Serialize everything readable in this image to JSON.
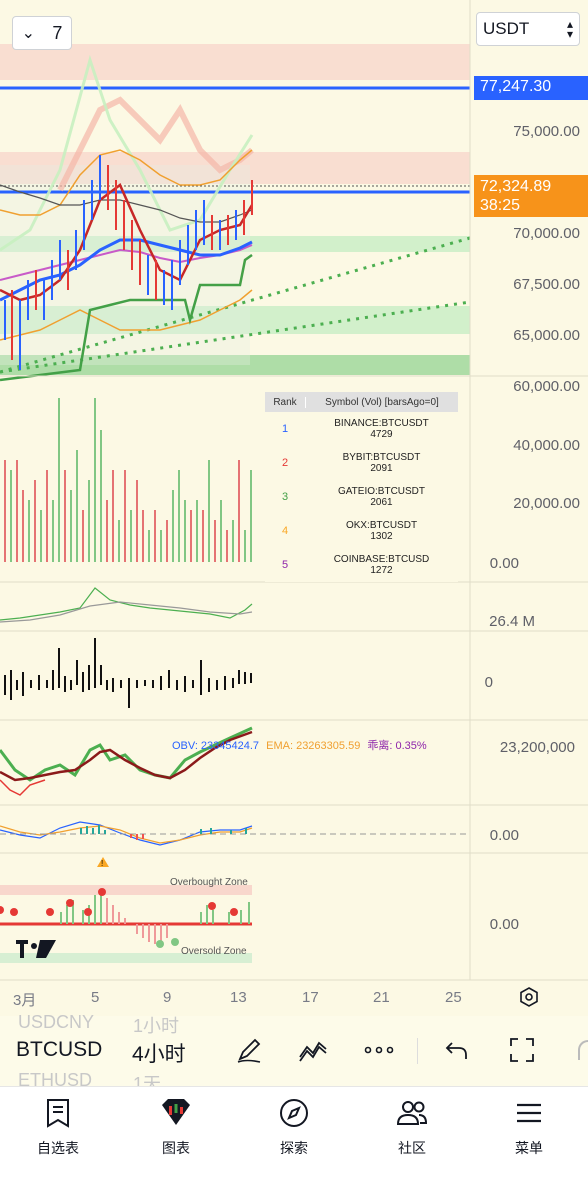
{
  "toolbar_top": {
    "interval_button": {
      "chevron": "chevron-down-icon",
      "value": "7"
    },
    "currency_button": {
      "label": "USDT",
      "icon": "chevron-up-down-icon"
    }
  },
  "price_axis": {
    "labels": [
      "75,000.00",
      "70,000.00",
      "67,500.00",
      "65,000.00",
      "60,000.00",
      "40,000.00",
      "20,000.00",
      "0.00",
      "26.4 M",
      "0",
      "23,200,000",
      "0.00",
      "0.00"
    ],
    "tag_top": {
      "value": "77,247.30",
      "color": "#2962ff"
    },
    "tag_current": {
      "value": "72,324.89",
      "countdown": "38:25",
      "color": "#f7931a"
    }
  },
  "volume_rank": {
    "headers": [
      "Rank",
      "Symbol (Vol)  [barsAgo=0]"
    ],
    "rows": [
      {
        "rank": "1",
        "symbol": "BINANCE:BTCUSDT",
        "vol": "4729",
        "color": "#2962ff"
      },
      {
        "rank": "2",
        "symbol": "BYBIT:BTCUSDT",
        "vol": "2091",
        "color": "#e53935"
      },
      {
        "rank": "3",
        "symbol": "GATEIO:BTCUSDT",
        "vol": "2061",
        "color": "#43a047"
      },
      {
        "rank": "4",
        "symbol": "OKX:BTCUSDT",
        "vol": "1302",
        "color": "#f9a825"
      },
      {
        "rank": "5",
        "symbol": "COINBASE:BTCUSD",
        "vol": "1272",
        "color": "#8e24aa"
      }
    ]
  },
  "obv_legend": {
    "obv": "OBV: 23345424.7",
    "ema": "EMA: 23263305.59",
    "deviation": "乖离: 0.35%"
  },
  "rsi_labels": {
    "overbought": "Overbought Zone",
    "oversold": "Oversold Zone"
  },
  "x_axis": {
    "labels": [
      "3月",
      "5",
      "9",
      "13",
      "17",
      "21",
      "25"
    ]
  },
  "bottom_toolbar": {
    "symbol_prev": "USDCNY",
    "symbol": "BTCUSD",
    "symbol_next": "ETHUSD",
    "tf_prev": "1小时",
    "timeframe": "4小时",
    "tf_next": "1天",
    "icons": [
      "pen-icon",
      "line-tool-icon",
      "more-icon",
      "undo-icon",
      "fullscreen-icon"
    ]
  },
  "bottom_nav": [
    {
      "label": "自选表",
      "icon": "watchlist-icon"
    },
    {
      "label": "图表",
      "icon": "chart-icon"
    },
    {
      "label": "探索",
      "icon": "compass-icon"
    },
    {
      "label": "社区",
      "icon": "community-icon"
    },
    {
      "label": "菜单",
      "icon": "menu-icon"
    }
  ]
}
